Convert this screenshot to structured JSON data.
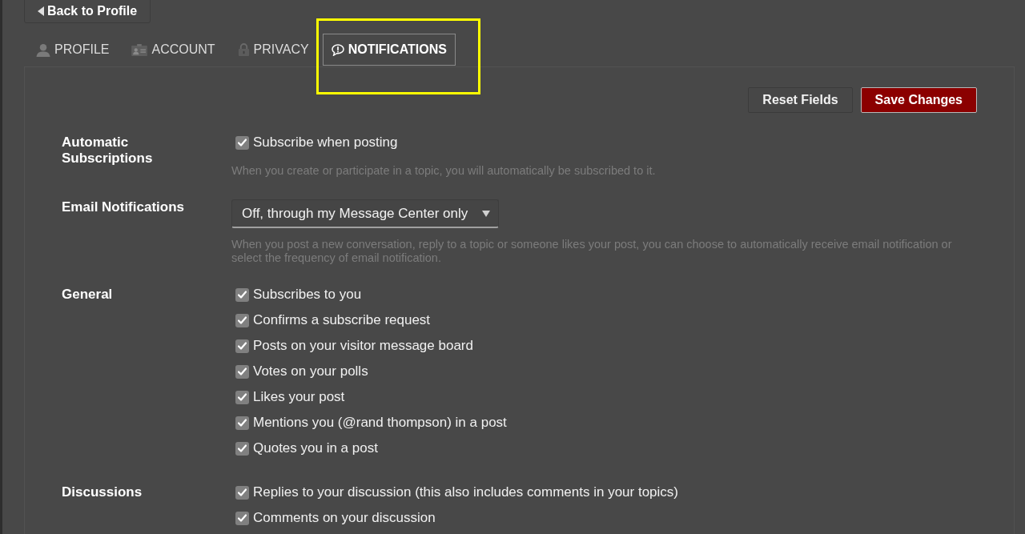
{
  "back_button": {
    "label": "Back to Profile"
  },
  "tabs": [
    {
      "label": "PROFILE",
      "selected": false
    },
    {
      "label": "ACCOUNT",
      "selected": false
    },
    {
      "label": "PRIVACY",
      "selected": false
    },
    {
      "label": "NOTIFICATIONS",
      "selected": true
    }
  ],
  "actions": [
    {
      "label": "Reset Fields",
      "kind": "secondary"
    },
    {
      "label": "Save Changes",
      "kind": "primary"
    }
  ],
  "sections": [
    {
      "kind": "checkboxes",
      "title": "Automatic Subscriptions",
      "options": [
        {
          "label": "Subscribe when posting",
          "checked": true
        }
      ],
      "hint": "When you create or participate in a topic, you will automatically be subscribed to it."
    },
    {
      "kind": "select",
      "title": "Email Notifications",
      "select": {
        "value": "Off, through my Message Center only"
      },
      "hint": "When you post a new conversation, reply to a topic or someone likes your post, you can choose to automatically receive email notification or select the frequency of email notification."
    },
    {
      "kind": "checkboxes",
      "title": "General",
      "options": [
        {
          "label": "Subscribes to you",
          "checked": true
        },
        {
          "label": "Confirms a subscribe request",
          "checked": true
        },
        {
          "label": "Posts on your visitor message board",
          "checked": true
        },
        {
          "label": "Votes on your polls",
          "checked": true
        },
        {
          "label": "Likes your post",
          "checked": true
        },
        {
          "label": "Mentions you (@rand thompson) in a post",
          "checked": true
        },
        {
          "label": "Quotes you in a post",
          "checked": true
        }
      ]
    },
    {
      "kind": "checkboxes",
      "title": "Discussions",
      "options": [
        {
          "label": "Replies to your discussion (this also includes comments in your topics)",
          "checked": true
        },
        {
          "label": "Comments on your discussion",
          "checked": true
        }
      ]
    }
  ]
}
